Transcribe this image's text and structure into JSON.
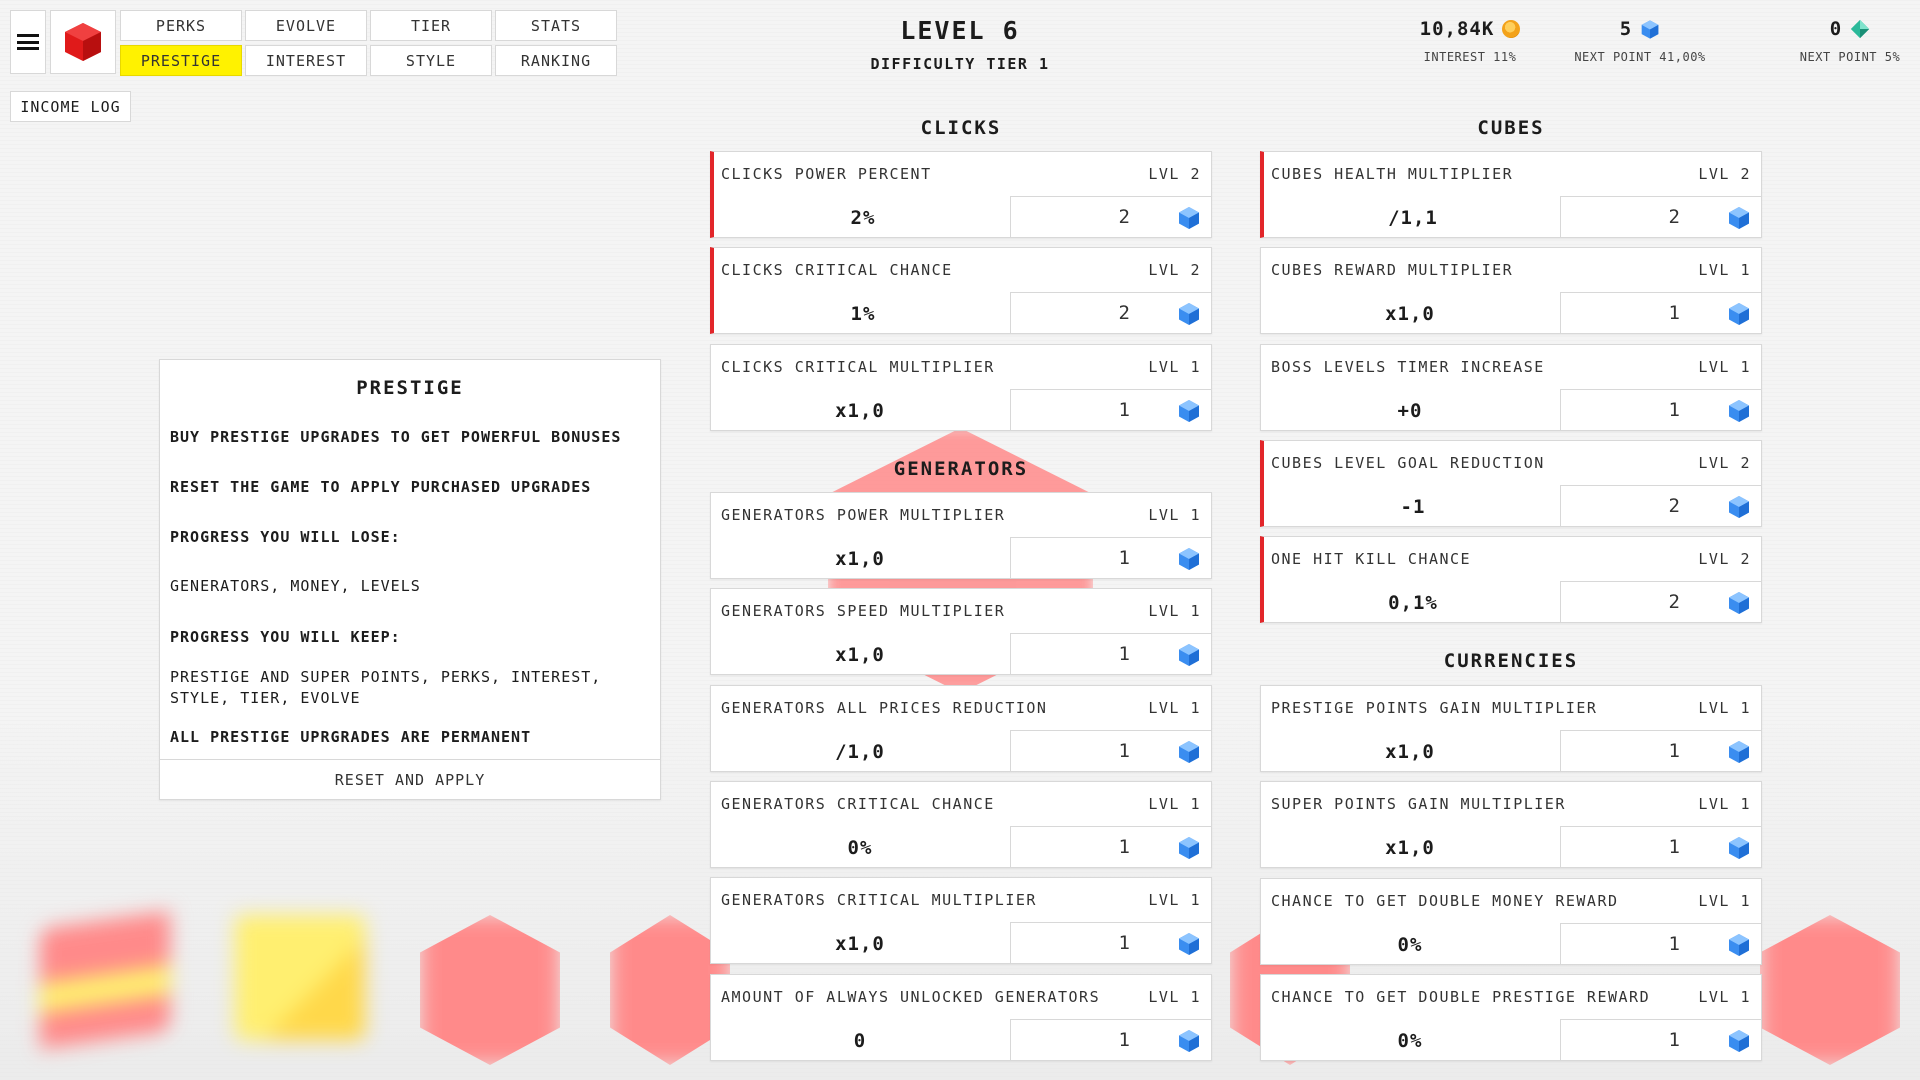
{
  "tabs": [
    {
      "label": "PERKS",
      "active": false
    },
    {
      "label": "EVOLVE",
      "active": false
    },
    {
      "label": "TIER",
      "active": false
    },
    {
      "label": "STATS",
      "active": false
    },
    {
      "label": "PRESTIGE",
      "active": true
    },
    {
      "label": "INTEREST",
      "active": false
    },
    {
      "label": "STYLE",
      "active": false
    },
    {
      "label": "RANKING",
      "active": false
    }
  ],
  "income_log_label": "INCOME LOG",
  "level": {
    "title": "LEVEL 6",
    "difficulty": "DIFFICULTY TIER 1"
  },
  "stats": {
    "money": {
      "value": "10,84K",
      "sub": "INTEREST 11%",
      "icon": "coin-icon"
    },
    "prestige_points": {
      "value": "5",
      "sub": "NEXT POINT 41,00%",
      "icon": "blue-gem-icon"
    },
    "super_points": {
      "value": "0",
      "sub": "NEXT POINT 5%",
      "icon": "green-gem-icon"
    }
  },
  "prestige_panel": {
    "title": "PRESTIGE",
    "line1": "BUY PRESTIGE UPGRADES TO GET POWERFUL BONUSES",
    "line2": "RESET THE GAME TO APPLY PURCHASED UPGRADES",
    "lose_title": "PROGRESS YOU WILL LOSE:",
    "lose_items": "GENERATORS, MONEY, LEVELS",
    "keep_title": "PROGRESS YOU WILL KEEP:",
    "keep_items_1": "PRESTIGE AND SUPER POINTS, PERKS, INTEREST,",
    "keep_items_2": "STYLE, TIER, EVOLVE",
    "permanent_note": "ALL PRESTIGE UPRGRADES ARE PERMANENT",
    "reset_button": "RESET AND APPLY"
  },
  "sections": {
    "clicks": {
      "title": "CLICKS",
      "items": [
        {
          "name": "CLICKS POWER PERCENT",
          "lvl": "LVL 2",
          "value": "2%",
          "cost": "2",
          "highlighted": true
        },
        {
          "name": "CLICKS CRITICAL CHANCE",
          "lvl": "LVL 2",
          "value": "1%",
          "cost": "2",
          "highlighted": true
        },
        {
          "name": "CLICKS CRITICAL MULTIPLIER",
          "lvl": "LVL 1",
          "value": "x1,0",
          "cost": "1",
          "highlighted": false
        }
      ]
    },
    "generators": {
      "title": "GENERATORS",
      "items": [
        {
          "name": "GENERATORS POWER MULTIPLIER",
          "lvl": "LVL 1",
          "value": "x1,0",
          "cost": "1",
          "highlighted": false
        },
        {
          "name": "GENERATORS SPEED MULTIPLIER",
          "lvl": "LVL 1",
          "value": "x1,0",
          "cost": "1",
          "highlighted": false
        },
        {
          "name": "GENERATORS ALL PRICES REDUCTION",
          "lvl": "LVL 1",
          "value": "/1,0",
          "cost": "1",
          "highlighted": false
        },
        {
          "name": "GENERATORS CRITICAL CHANCE",
          "lvl": "LVL 1",
          "value": "0%",
          "cost": "1",
          "highlighted": false
        },
        {
          "name": "GENERATORS CRITICAL MULTIPLIER",
          "lvl": "LVL 1",
          "value": "x1,0",
          "cost": "1",
          "highlighted": false
        },
        {
          "name": "AMOUNT OF ALWAYS UNLOCKED GENERATORS",
          "lvl": "LVL 1",
          "value": "0",
          "cost": "1",
          "highlighted": false
        }
      ]
    },
    "cubes": {
      "title": "CUBES",
      "items": [
        {
          "name": "CUBES HEALTH MULTIPLIER",
          "lvl": "LVL 2",
          "value": "/1,1",
          "cost": "2",
          "highlighted": true
        },
        {
          "name": "CUBES REWARD MULTIPLIER",
          "lvl": "LVL 1",
          "value": "x1,0",
          "cost": "1",
          "highlighted": false
        },
        {
          "name": "BOSS LEVELS TIMER INCREASE",
          "lvl": "LVL 1",
          "value": "+0",
          "cost": "1",
          "highlighted": false
        },
        {
          "name": "CUBES LEVEL GOAL REDUCTION",
          "lvl": "LVL 2",
          "value": "-1",
          "cost": "2",
          "highlighted": true
        },
        {
          "name": "ONE HIT KILL CHANCE",
          "lvl": "LVL 2",
          "value": "0,1%",
          "cost": "2",
          "highlighted": true
        }
      ]
    },
    "currencies": {
      "title": "CURRENCIES",
      "items": [
        {
          "name": "PRESTIGE POINTS GAIN MULTIPLIER",
          "lvl": "LVL 1",
          "value": "x1,0",
          "cost": "1",
          "highlighted": false
        },
        {
          "name": "SUPER POINTS GAIN MULTIPLIER",
          "lvl": "LVL 1",
          "value": "x1,0",
          "cost": "1",
          "highlighted": false
        },
        {
          "name": "CHANCE TO GET DOUBLE MONEY REWARD",
          "lvl": "LVL 1",
          "value": "0%",
          "cost": "1",
          "highlighted": false
        },
        {
          "name": "CHANCE TO GET DOUBLE PRESTIGE REWARD",
          "lvl": "LVL 1",
          "value": "0%",
          "cost": "1",
          "highlighted": false
        }
      ]
    }
  },
  "colors": {
    "accent_yellow": "#fff200",
    "highlight_red": "#e2262a",
    "gem_blue": "#3a8df0",
    "gem_green": "#2bb99a"
  }
}
